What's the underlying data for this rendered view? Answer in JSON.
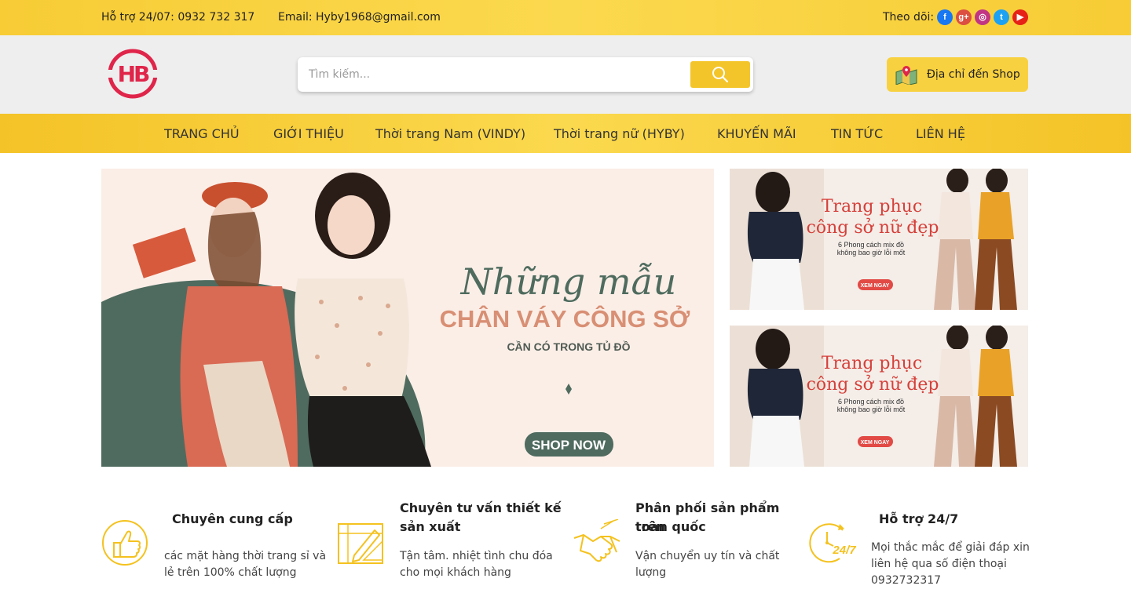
{
  "topbar": {
    "support": "Hỗ trợ 24/07: 0932 732 317",
    "email": "Email: Hyby1968@gmail.com",
    "follow": "Theo dõi:",
    "socials": [
      {
        "icon": "facebook-icon",
        "glyph": "f",
        "color": "#1877f2"
      },
      {
        "icon": "google-plus-icon",
        "glyph": "g+",
        "color": "#dc4e41"
      },
      {
        "icon": "instagram-icon",
        "glyph": "◎",
        "color": "#c13584"
      },
      {
        "icon": "twitter-icon",
        "glyph": "t",
        "color": "#1da1f2"
      },
      {
        "icon": "youtube-icon",
        "glyph": "▶",
        "color": "#e62117"
      }
    ]
  },
  "header": {
    "logo_text": "HB",
    "search_placeholder": "Tìm kiếm...",
    "shop_address": "Địa chỉ đến Shop"
  },
  "nav": {
    "items": [
      "TRANG CHỦ",
      "GIỚI THIỆU",
      "Thời trang Nam (VINDY)",
      "Thời trang nữ (HYBY)",
      "KHUYẾN MÃI",
      "TIN TỨC",
      "LIÊN HỆ"
    ]
  },
  "hero": {
    "script_title": "Những mẫu",
    "title": "CHÂN VÁY CÔNG SỞ",
    "subtitle": "CẦN CÓ TRONG TỦ ĐỒ",
    "cta": "SHOP NOW"
  },
  "side_banners": [
    {
      "title_line1": "Trang phục",
      "title_line2": "công sở nữ đẹp",
      "desc_line1": "6 Phong cách mix đồ",
      "desc_line2": "không bao giờ lỗi mốt",
      "cta": "XEM NGAY"
    },
    {
      "title_line1": "Trang phục",
      "title_line2": "công sở nữ đẹp",
      "desc_line1": "6 Phong cách mix đồ",
      "desc_line2": "không bao giờ lỗi mốt",
      "cta": "XEM NGAY"
    }
  ],
  "features": [
    {
      "icon": "thumbs-up-icon",
      "title_line1": "Chuyên cung cấp",
      "title_line2": "",
      "desc_line1": "các mặt hàng thời trang sỉ và",
      "desc_line2": "lẻ trên 100% chất lượng",
      "desc_line3": ""
    },
    {
      "icon": "design-icon",
      "title_line1": "Chuyên tư vấn thiết kế",
      "title_line2": "sản xuất",
      "desc_line1": "Tận tâm. nhiệt tình chu đóa",
      "desc_line2": "cho mọi khách hàng",
      "desc_line3": ""
    },
    {
      "icon": "handshake-icon",
      "title_line1": "Phân phối sản phẩm trên",
      "title_line2": "toàn quốc",
      "desc_line1": "Vận chuyển uy tín và chất",
      "desc_line2": "lượng",
      "desc_line3": ""
    },
    {
      "icon": "support-24-7-icon",
      "icon_text": "24/7",
      "title_line1": "Hỗ trợ 24/7",
      "title_line2": "",
      "desc_line1": "Mọi thắc mắc để giải đáp xin",
      "desc_line2": "liên hệ qua số điện thoại",
      "desc_line3": "0932732317"
    }
  ],
  "colors": {
    "accent": "#f8d140",
    "logo_red": "#e0254a",
    "icon_yellow": "#f4c21f"
  }
}
